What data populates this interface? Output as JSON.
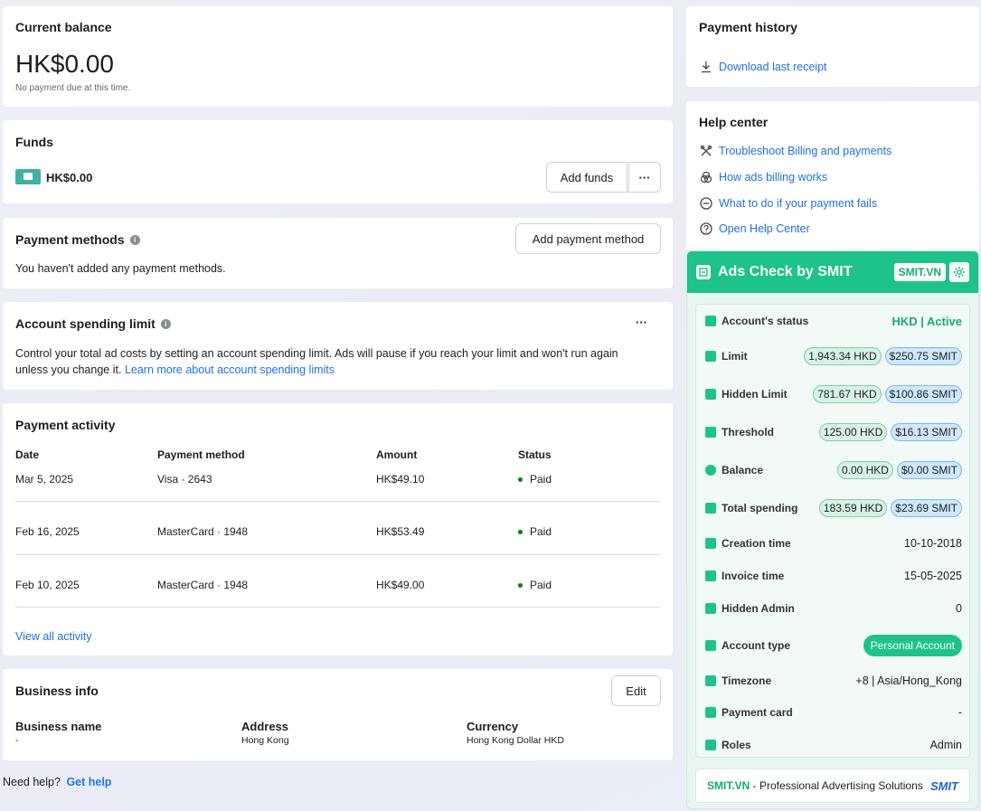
{
  "balance": {
    "title": "Current balance",
    "amount": "HK$0.00",
    "note": "No payment due at this time."
  },
  "funds": {
    "title": "Funds",
    "amount": "HK$0.00",
    "add_label": "Add funds",
    "more_label": "···"
  },
  "payment_methods": {
    "title": "Payment methods",
    "info": "i",
    "add_label": "Add payment method",
    "empty": "You haven't added any payment methods."
  },
  "spending_limit": {
    "title": "Account spending limit",
    "info": "i",
    "more_label": "···",
    "desc": "Control your total ad costs by setting an account spending limit. Ads will pause if you reach your limit and won't run again unless you change it.",
    "link": "Learn more about account spending limits"
  },
  "activity": {
    "title": "Payment activity",
    "headers": {
      "date": "Date",
      "method": "Payment method",
      "amount": "Amount",
      "status": "Status"
    },
    "rows": [
      {
        "date": "Mar 5, 2025",
        "method": "Visa · 2643",
        "amount": "HK$49.10",
        "status": "Paid"
      },
      {
        "date": "Feb 16, 2025",
        "method": "MasterCard · 1948",
        "amount": "HK$53.49",
        "status": "Paid"
      },
      {
        "date": "Feb 10, 2025",
        "method": "MasterCard · 1948",
        "amount": "HK$49.00",
        "status": "Paid"
      }
    ],
    "view_all": "View all activity"
  },
  "business": {
    "title": "Business info",
    "edit_label": "Edit",
    "name_label": "Business name",
    "name_value": "-",
    "address_label": "Address",
    "address_value": "Hong Kong",
    "currency_label": "Currency",
    "currency_value": "Hong Kong Dollar HKD"
  },
  "help_footer": {
    "text": "Need help?",
    "link": "Get help"
  },
  "history": {
    "title": "Payment history",
    "download": "Download last receipt"
  },
  "help_center": {
    "title": "Help center",
    "links": [
      "Troubleshoot Billing and payments",
      "How ads billing works",
      "What to do if your payment fails",
      "Open Help Center"
    ]
  },
  "smit": {
    "title": "Ads Check by SMIT",
    "badge": "SMIT.VN",
    "status_label": "Account's status",
    "status_value": "HKD | Active",
    "limit_label": "Limit",
    "limit_hkd": "1,943.34 HKD",
    "limit_smit": "$250.75 SMIT",
    "hidden_limit_label": "Hidden Limit",
    "hidden_limit_hkd": "781.67 HKD",
    "hidden_limit_smit": "$100.86 SMIT",
    "threshold_label": "Threshold",
    "threshold_hkd": "125.00 HKD",
    "threshold_smit": "$16.13 SMIT",
    "balance_label": "Balance",
    "balance_hkd": "0.00 HKD",
    "balance_smit": "$0.00 SMIT",
    "spending_label": "Total spending",
    "spending_hkd": "183.59 HKD",
    "spending_smit": "$23.69 SMIT",
    "creation_label": "Creation time",
    "creation_value": "10-10-2018",
    "invoice_label": "Invoice time",
    "invoice_value": "15-05-2025",
    "admin_label": "Hidden Admin",
    "admin_value": "0",
    "type_label": "Account type",
    "type_value": "Personal Account",
    "tz_label": "Timezone",
    "tz_value": "+8 | Asia/Hong_Kong",
    "card_label": "Payment card",
    "card_value": "-",
    "roles_label": "Roles",
    "roles_value": "Admin",
    "footer_brand": "SMIT.VN",
    "footer_text": " - Professional Advertising Solutions",
    "footer_logo": "SMIT",
    "accent": "#1ec28b"
  }
}
